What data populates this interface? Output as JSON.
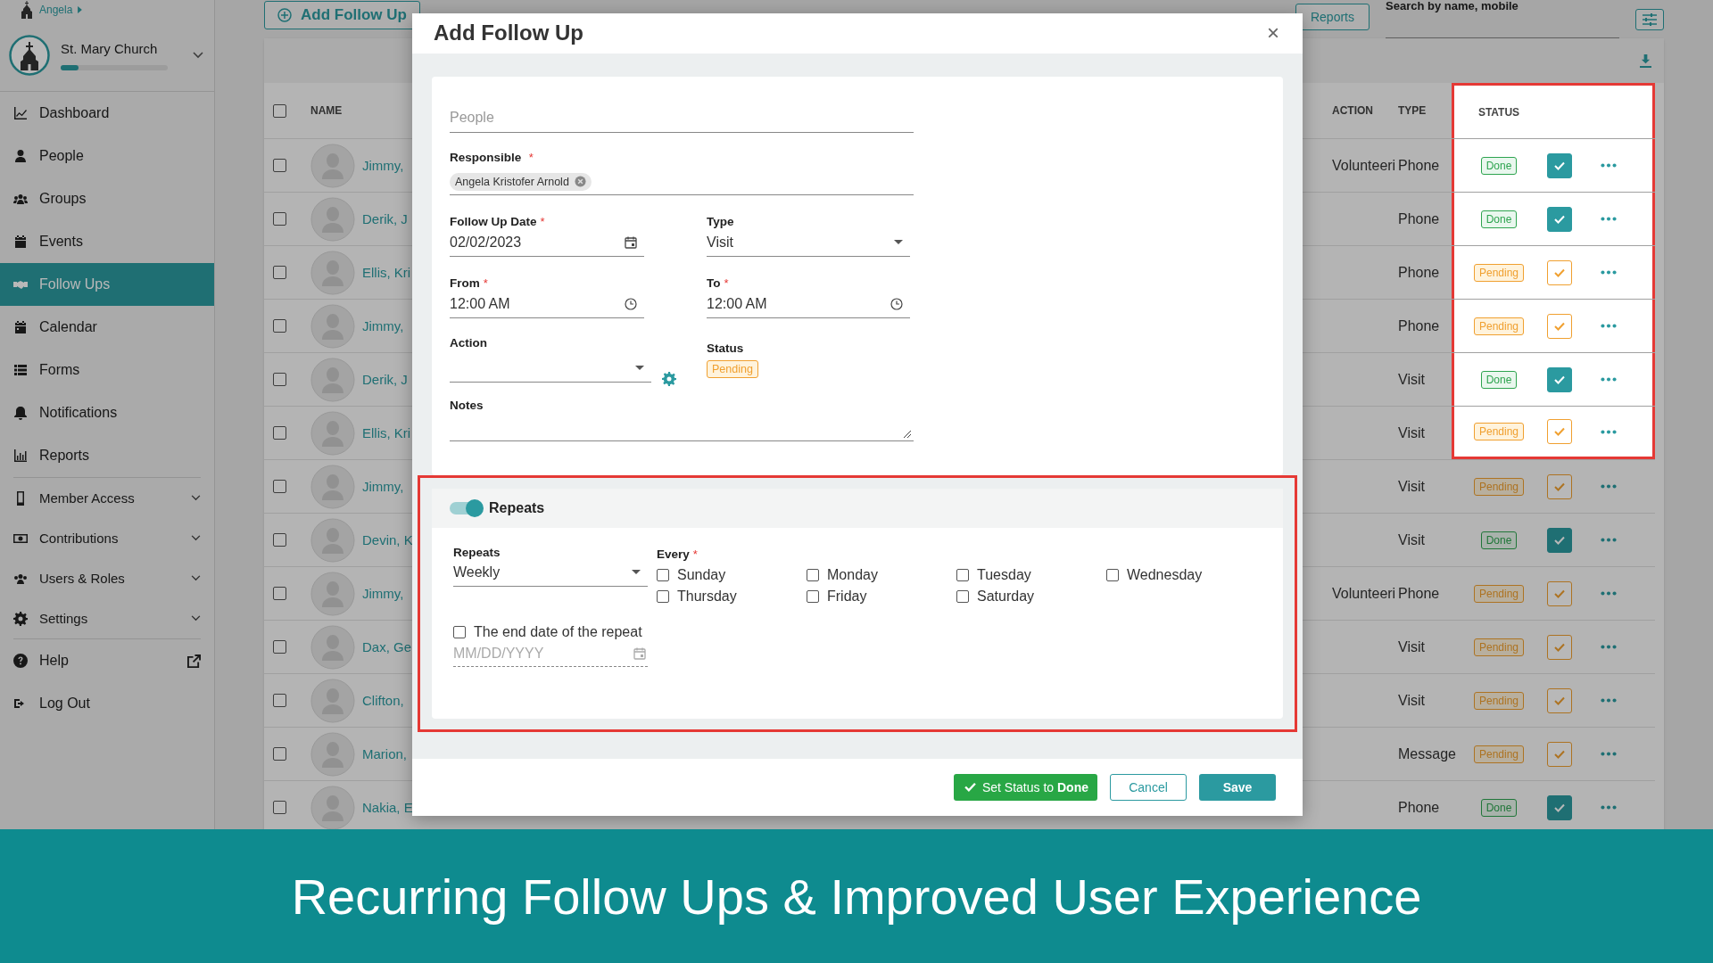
{
  "sidebar": {
    "user": "Angela",
    "organization": "St. Mary Church",
    "progress": {
      "level": 0.17
    },
    "sections": [
      {
        "items": [
          {
            "label": "Dashboard",
            "selected": false,
            "kind": "link"
          },
          {
            "label": "People",
            "selected": false,
            "kind": "link"
          },
          {
            "label": "Groups",
            "selected": false,
            "kind": "link"
          },
          {
            "label": "Events",
            "selected": false,
            "kind": "link"
          },
          {
            "label": "Follow Ups",
            "selected": true,
            "kind": "link"
          },
          {
            "label": "Calendar",
            "selected": false,
            "kind": "link"
          },
          {
            "label": "Forms",
            "selected": false,
            "kind": "link"
          },
          {
            "label": "Notifications",
            "selected": false,
            "kind": "link"
          },
          {
            "label": "Reports",
            "selected": false,
            "kind": "link"
          }
        ]
      },
      {
        "items": [
          {
            "label": "Member Access",
            "selected": false,
            "kind": "group"
          },
          {
            "label": "Contributions",
            "selected": false,
            "kind": "group"
          },
          {
            "label": "Users & Roles",
            "selected": false,
            "kind": "group"
          },
          {
            "label": "Settings",
            "selected": false,
            "kind": "group"
          }
        ]
      },
      {
        "items": [
          {
            "label": "Help",
            "selected": false,
            "kind": "external"
          },
          {
            "label": "Log Out",
            "selected": false,
            "kind": "link"
          }
        ]
      }
    ]
  },
  "toolbar": {
    "add_button": "Add Follow Up",
    "reports_button": "Reports",
    "search": {
      "label": "Search by name, mobile"
    }
  },
  "table": {
    "select_all": {
      "checked": false
    },
    "columns": [
      "NAME",
      "ACTION",
      "TYPE",
      "STATUS"
    ],
    "rows": [
      {
        "checked": false,
        "name": "Jimmy,",
        "action": "Volunteeri",
        "type": "Phone",
        "status": "Done",
        "done": true,
        "highlighted": true
      },
      {
        "checked": false,
        "name": "Derik, J",
        "type": "Phone",
        "status": "Done",
        "done": true,
        "highlighted": true
      },
      {
        "checked": false,
        "name": "Ellis, Kri",
        "type": "Phone",
        "status": "Pending",
        "done": false,
        "highlighted": true
      },
      {
        "checked": false,
        "name": "Jimmy,",
        "type": "Phone",
        "status": "Pending",
        "done": false,
        "highlighted": true
      },
      {
        "checked": false,
        "name": "Derik, J",
        "type": "Visit",
        "status": "Done",
        "done": true,
        "highlighted": true
      },
      {
        "checked": false,
        "name": "Ellis, Kri",
        "type": "Visit",
        "status": "Pending",
        "done": false,
        "highlighted": true
      },
      {
        "checked": false,
        "name": "Jimmy,",
        "type": "Visit",
        "status": "Pending",
        "done": false,
        "highlighted": false
      },
      {
        "checked": false,
        "name": "Devin, K",
        "type": "Visit",
        "status": "Done",
        "done": true,
        "highlighted": false
      },
      {
        "checked": false,
        "name": "Jimmy,",
        "action": "Volunteeri",
        "type": "Phone",
        "status": "Pending",
        "done": false,
        "highlighted": false
      },
      {
        "checked": false,
        "name": "Dax, Ge",
        "type": "Visit",
        "status": "Pending",
        "done": false,
        "highlighted": false
      },
      {
        "checked": false,
        "name": "Clifton,",
        "type": "Visit",
        "status": "Pending",
        "done": false,
        "highlighted": false
      },
      {
        "checked": false,
        "name": "Marion,",
        "type": "Message",
        "status": "Pending",
        "done": false,
        "highlighted": false
      },
      {
        "checked": false,
        "name": "Nakia, E",
        "type": "Phone",
        "status": "Done",
        "done": true,
        "highlighted": false
      }
    ]
  },
  "modal": {
    "title": "Add Follow Up",
    "close": "×",
    "people": {
      "placeholder": "People"
    },
    "responsible": {
      "label": "Responsible",
      "required": "*",
      "chips": [
        "Angela Kristofer Arnold"
      ]
    },
    "follow_up_date": {
      "label": "Follow Up Date",
      "required": "*",
      "value": "02/02/2023"
    },
    "type": {
      "label": "Type",
      "value": "Visit"
    },
    "from": {
      "label": "From",
      "required": "*",
      "value": "12:00 AM"
    },
    "to": {
      "label": "To",
      "required": "*",
      "value": "12:00 AM"
    },
    "action": {
      "label": "Action"
    },
    "status": {
      "label": "Status",
      "value": "Pending",
      "done": false
    },
    "notes": {
      "label": "Notes"
    },
    "repeats": {
      "highlighted": true,
      "on": true,
      "title": "Repeats",
      "frequency": {
        "label": "Repeats",
        "value": "Weekly"
      },
      "every": {
        "label": "Every",
        "required": "*",
        "days": [
          {
            "label": "Sunday",
            "checked": false
          },
          {
            "label": "Monday",
            "checked": false
          },
          {
            "label": "Tuesday",
            "checked": false
          },
          {
            "label": "Wednesday",
            "checked": false
          },
          {
            "label": "Thursday",
            "checked": false
          },
          {
            "label": "Friday",
            "checked": false
          },
          {
            "label": "Saturday",
            "checked": false
          }
        ]
      },
      "end_date": {
        "label": "The end date of the repeat",
        "checked": false,
        "placeholder": "MM/DD/YYYY"
      }
    },
    "buttons": {
      "set_status": "Set Status to **Done**",
      "cancel": "Cancel",
      "save": "Save"
    }
  },
  "banner": {
    "text": "Recurring Follow Ups & Improved User Experience"
  }
}
